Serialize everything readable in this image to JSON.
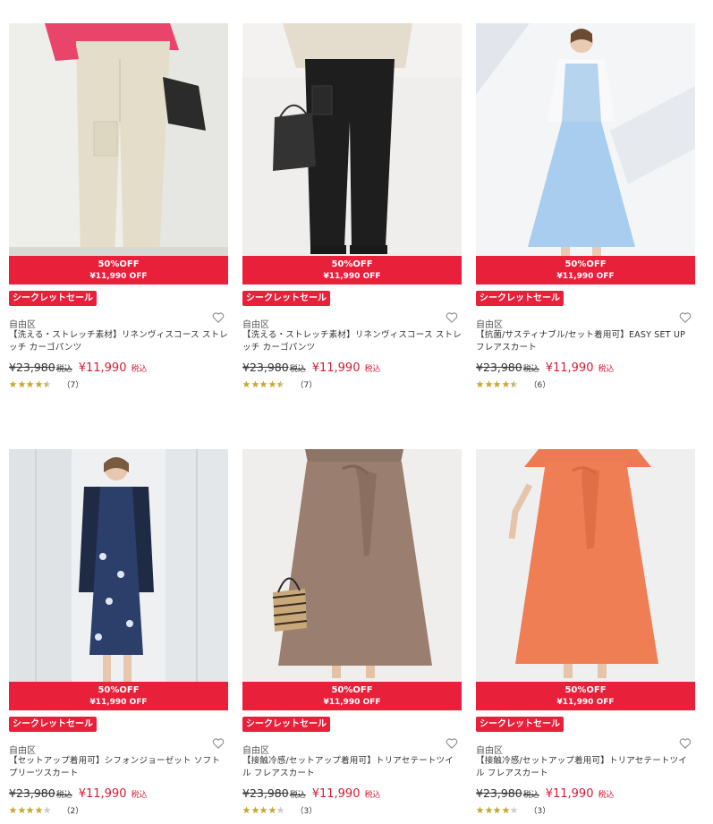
{
  "colors": {
    "sale_red": "#e8203a",
    "price_red": "#d51c36",
    "star_gold": "#c8a832",
    "star_grey": "#cccccc"
  },
  "products": [
    {
      "image": "beige-cargo-pants",
      "discount": "50%OFF",
      "sale_price_label": "¥11,990 OFF",
      "badge": "シークレットセール",
      "brand": "自由区",
      "name": "【洗える・ストレッチ素材】リネンヴィスコース ストレッチ カーゴパンツ",
      "original_price": "¥23,980",
      "tax_label": "税込",
      "price": "¥11,990",
      "rating": 4.5,
      "review_count": "（7）",
      "favorite_icon": "heart-outline-icon"
    },
    {
      "image": "black-cargo-pants",
      "discount": "50%OFF",
      "sale_price_label": "¥11,990 OFF",
      "badge": "シークレットセール",
      "brand": "自由区",
      "name": "【洗える・ストレッチ素材】リネンヴィスコース ストレッチ カーゴパンツ",
      "original_price": "¥23,980",
      "tax_label": "税込",
      "price": "¥11,990",
      "rating": 4.5,
      "review_count": "（7）",
      "favorite_icon": "heart-outline-icon"
    },
    {
      "image": "light-blue-flare-skirt-set",
      "discount": "50%OFF",
      "sale_price_label": "¥11,990 OFF",
      "badge": "シークレットセール",
      "brand": "自由区",
      "name": "【抗菌/サスティナブル/セット着用可】EASY SET UP フレアスカート",
      "original_price": "¥23,980",
      "tax_label": "税込",
      "price": "¥11,990",
      "rating": 4.5,
      "review_count": "（6）",
      "favorite_icon": "heart-outline-icon"
    },
    {
      "image": "navy-floral-pleats-skirt",
      "discount": "50%OFF",
      "sale_price_label": "¥11,990 OFF",
      "badge": "シークレットセール",
      "brand": "自由区",
      "name": "【セットアップ着用可】シフォンジョーゼット ソフトプリーツスカート",
      "original_price": "¥23,980",
      "tax_label": "税込",
      "price": "¥11,990",
      "rating": 4,
      "review_count": "（2）",
      "favorite_icon": "heart-outline-icon"
    },
    {
      "image": "brown-flare-skirt",
      "discount": "50%OFF",
      "sale_price_label": "¥11,990 OFF",
      "badge": "シークレットセール",
      "brand": "自由区",
      "name": "【接触冷感/セットアップ着用可】トリアセテートツイル フレアスカート",
      "original_price": "¥23,980",
      "tax_label": "税込",
      "price": "¥11,990",
      "rating": 4,
      "review_count": "（3）",
      "favorite_icon": "heart-outline-icon"
    },
    {
      "image": "orange-flare-skirt",
      "discount": "50%OFF",
      "sale_price_label": "¥11,990 OFF",
      "badge": "シークレットセール",
      "brand": "自由区",
      "name": "【接触冷感/セットアップ着用可】トリアセテートツイル フレアスカート",
      "original_price": "¥23,980",
      "tax_label": "税込",
      "price": "¥11,990",
      "rating": 4,
      "review_count": "（3）",
      "favorite_icon": "heart-outline-icon"
    }
  ]
}
